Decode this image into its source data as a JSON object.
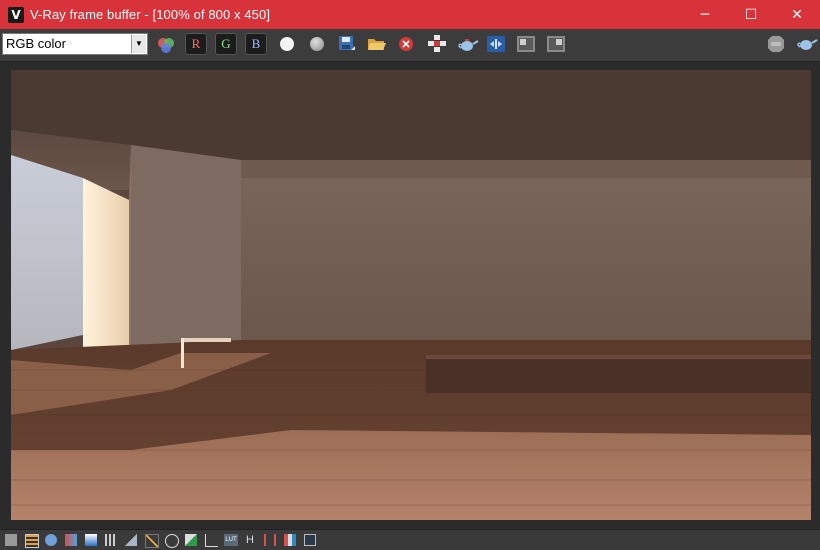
{
  "window": {
    "title": "V-Ray frame buffer - [100% of 800 x 450]",
    "logo_letter": "V",
    "minimize_glyph": "─",
    "maximize_glyph": "☐",
    "close_glyph": "✕",
    "accent_color": "#d8333a"
  },
  "toolbar": {
    "channel_value": "RGB color",
    "channel_arrow": "▼",
    "r_label": "R",
    "g_label": "G",
    "b_label": "B",
    "r_color": "#ff6b6b",
    "g_color": "#8fe08f",
    "b_color": "#9ab8ff",
    "icons": [
      "channels-color-wheel-icon",
      "red-channel-button",
      "green-channel-button",
      "blue-channel-button",
      "white-circle-icon",
      "grey-circle-icon",
      "save-image-icon",
      "open-image-icon",
      "clear-image-icon",
      "track-mouse-icon",
      "render-teapot-icon",
      "lens-effects-icon",
      "compare-a-icon",
      "compare-b-icon",
      "stop-render-icon",
      "region-render-teapot-icon"
    ]
  },
  "statusbar": {
    "icons": [
      "show-corrections-icon",
      "color-corrections-list-icon",
      "info-icon",
      "color-balance-icon",
      "hsl-icon",
      "levels-icon",
      "histogram-icon",
      "curve-icon",
      "white-balance-icon",
      "exposure-icon",
      "curves-graph-icon",
      "lut-icon",
      "h-letter-icon",
      "pixel-aspect-icon",
      "color-clamp-icon",
      "stamp-icon"
    ],
    "lut_label": "LUT",
    "h_label": "H"
  }
}
